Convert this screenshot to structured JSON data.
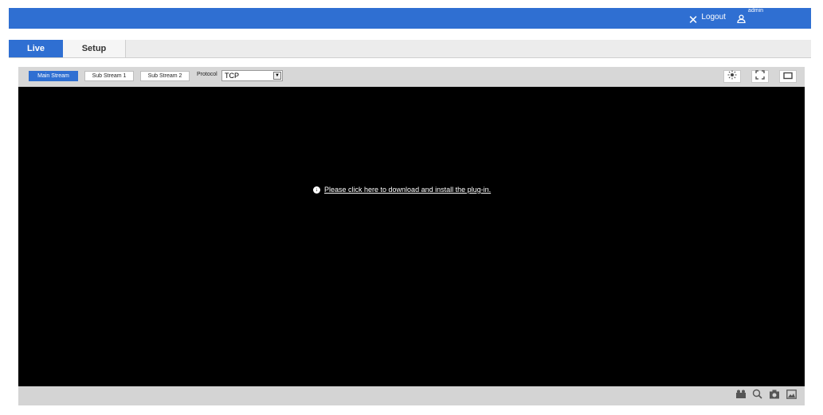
{
  "header": {
    "logout_label": "Logout",
    "username": "admin"
  },
  "tabs": [
    {
      "label": "Live",
      "active": true
    },
    {
      "label": "Setup",
      "active": false
    }
  ],
  "toolbar": {
    "streams": [
      {
        "label": "Main Stream",
        "active": true
      },
      {
        "label": "Sub Stream 1",
        "active": false
      },
      {
        "label": "Sub Stream 2",
        "active": false
      }
    ],
    "protocol_label": "Protocol",
    "protocol_value": "TCP",
    "right_icons": [
      "brightness-icon",
      "fullscreen-icon",
      "window-size-icon"
    ]
  },
  "video": {
    "plugin_message": "Please click here to download and install the plug-in."
  },
  "bottom_icons": [
    "record-icon",
    "zoom-icon",
    "snapshot-icon",
    "image-icon"
  ],
  "colors": {
    "accent": "#2f6fd2",
    "toolbar_bg": "#d7d7d7",
    "video_bg": "#000000"
  }
}
